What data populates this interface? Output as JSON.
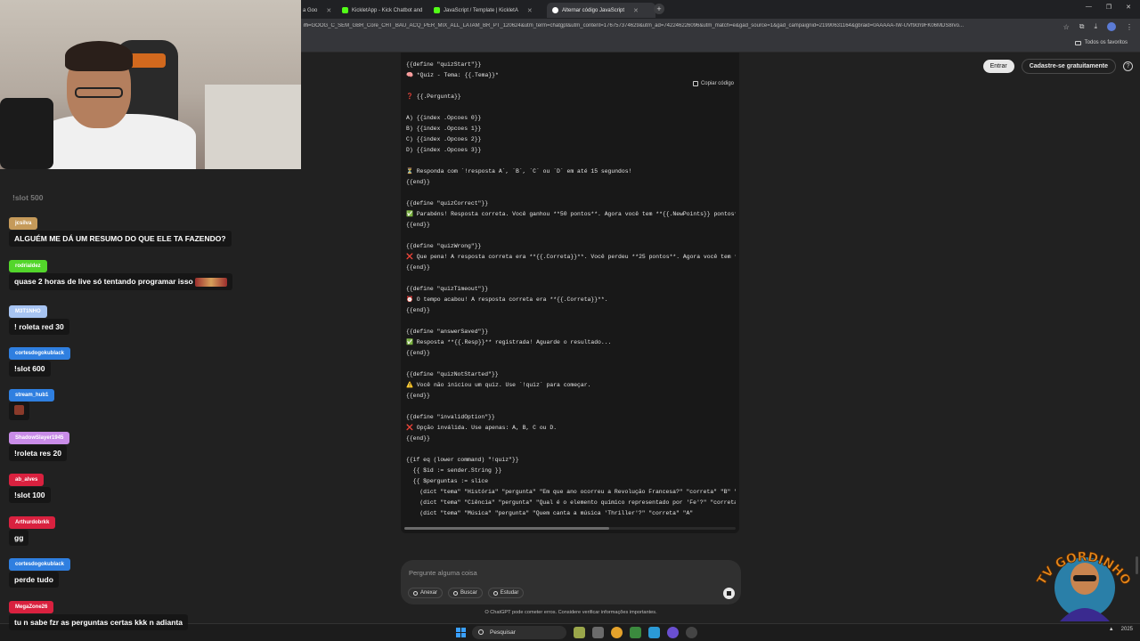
{
  "browser": {
    "tabs": [
      {
        "title": "a Goo",
        "color": "#4285f4",
        "active": false
      },
      {
        "title": "KickletApp - Kick Chatbot and",
        "color": "#53fc18",
        "active": false
      },
      {
        "title": "JavaScript / Template | KickletA",
        "color": "#53fc18",
        "active": false
      },
      {
        "title": "Alternar código JavaScript",
        "color": "#ffffff",
        "active": true
      }
    ],
    "url_prefix": "m",
    "url_rest": "=GOOG_C_SEM_GBR_Core_CHT_BAU_ACQ_PER_MIX_ALL_LATAM_BR_PT_120624&utm_term=chatgpt&utm_content=176757374629&utm_ad=742246226096&utm_match=e&gad_source=1&gad_campaignid=21990631164&gbraid=0AAAAA-IW-UVf9ch9FK06MDS8rvo...",
    "bookmarks_label": "Todos os favoritos"
  },
  "chatgpt": {
    "login_label": "Entrar",
    "signup_label": "Cadastre-se gratuitamente",
    "help_label": "?",
    "copy_label": "Copiar código",
    "composer_placeholder": "Pergunte alguma coisa",
    "tools": [
      "Anexar",
      "Buscar",
      "Estudar"
    ],
    "disclaimer": "O ChatGPT pode cometer erros. Considere verificar informações importantes.",
    "code_lines": [
      "{{define \"quizStart\"}}",
      "🧠 *Quiz - Tema: {{.Tema}}*",
      "",
      "❓ {{.Pergunta}}",
      "",
      "A) {{index .Opcoes 0}}",
      "B) {{index .Opcoes 1}}",
      "C) {{index .Opcoes 2}}",
      "D) {{index .Opcoes 3}}",
      "",
      "⏳ Responda com `!resposta A`, `B`, `C` ou `D` em até 15 segundos!",
      "{{end}}",
      "",
      "{{define \"quizCorrect\"}}",
      "✅ Parabéns! Resposta correta. Você ganhou **50 pontos**. Agora você tem **{{.NewPoints}} pontos*",
      "{{end}}",
      "",
      "{{define \"quizWrong\"}}",
      "❌ Que pena! A resposta correta era **{{.Correta}}**. Você perdeu **25 pontos**. Agora você tem *",
      "{{end}}",
      "",
      "{{define \"quizTimeout\"}}",
      "⏰ O tempo acabou! A resposta correta era **{{.Correta}}**.",
      "{{end}}",
      "",
      "{{define \"answerSaved\"}}",
      "✅ Resposta **{{.Resp}}** registrada! Aguarde o resultado...",
      "{{end}}",
      "",
      "{{define \"quizNotStarted\"}}",
      "⚠️ Você não iniciou um quiz. Use `!quiz` para começar.",
      "{{end}}",
      "",
      "{{define \"invalidOption\"}}",
      "❌ Opção inválida. Use apenas: A, B, C ou D.",
      "{{end}}",
      "",
      "{{if eq (lower command) \"!quiz\"}}",
      "  {{ $id := sender.String }}",
      "  {{ $perguntas := slice",
      "    (dict \"tema\" \"História\" \"pergunta\" \"Em que ano ocorreu a Revolução Francesa?\" \"correta\" \"B\" \"c",
      "    (dict \"tema\" \"Ciência\" \"pergunta\" \"Qual é o elemento químico representado por 'Fe'?\" \"correta\"",
      "    (dict \"tema\" \"Música\" \"pergunta\" \"Quem canta a música 'Thriller'?\" \"correta\" \"A\""
    ]
  },
  "taskbar": {
    "search_label": "Pesquisar",
    "tray_year": "2025"
  },
  "stream": {
    "logo_text": "TV GORDINHO",
    "chat": [
      {
        "user": "",
        "text": "!slot 500",
        "color": "#2a2a2a"
      },
      {
        "user": "jcsilva",
        "text": "ALGUÉM ME DÁ UM RESUMO DO QUE ELE TA FAZENDO?",
        "color": "#c59a5a"
      },
      {
        "user": "rodrialdez",
        "text": "quase 2 horas de live só tentando programar isso",
        "color": "#53d62b"
      },
      {
        "user": "M3T1NHO",
        "text": "! roleta red 30",
        "color": "#a7c4f2"
      },
      {
        "user": "cortesdogokublack",
        "text": "!slot 600",
        "color": "#2f7fe0"
      },
      {
        "user": "stream_hub1",
        "text": "",
        "color": "#2f7fe0"
      },
      {
        "user": "ShadowSlayer1945",
        "text": "!roleta res 20",
        "color": "#c98ce8"
      },
      {
        "user": "ab_alves",
        "text": "!slot 100",
        "color": "#d9213f"
      },
      {
        "user": "Arthurdobrkk",
        "text": "gg",
        "color": "#d9213f"
      },
      {
        "user": "cortesdogokublack",
        "text": "perde tudo",
        "color": "#2f7fe0"
      },
      {
        "user": "MegaZone26",
        "text": "tu n sabe fzr as perguntas certas kkk n adianta",
        "color": "#d9213f"
      }
    ]
  }
}
